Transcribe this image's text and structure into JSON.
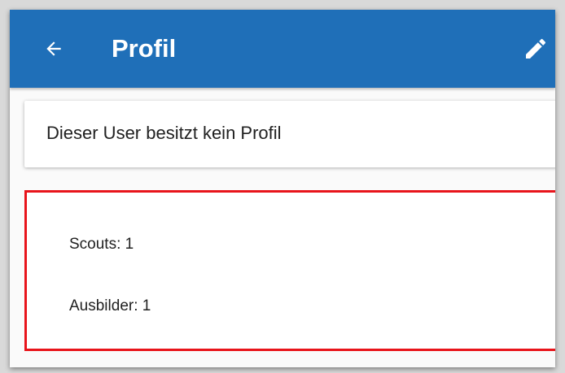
{
  "appbar": {
    "title": "Profil",
    "back_icon": "arrow-left-icon",
    "edit_icon": "pencil-icon",
    "background_color": "#1f6fb8"
  },
  "profile_card": {
    "message": "Dieser User besitzt kein Profil"
  },
  "stats": {
    "highlight_color": "#e8141b",
    "items": [
      {
        "label": "Scouts: 1"
      },
      {
        "label": "Ausbilder: 1"
      }
    ]
  }
}
